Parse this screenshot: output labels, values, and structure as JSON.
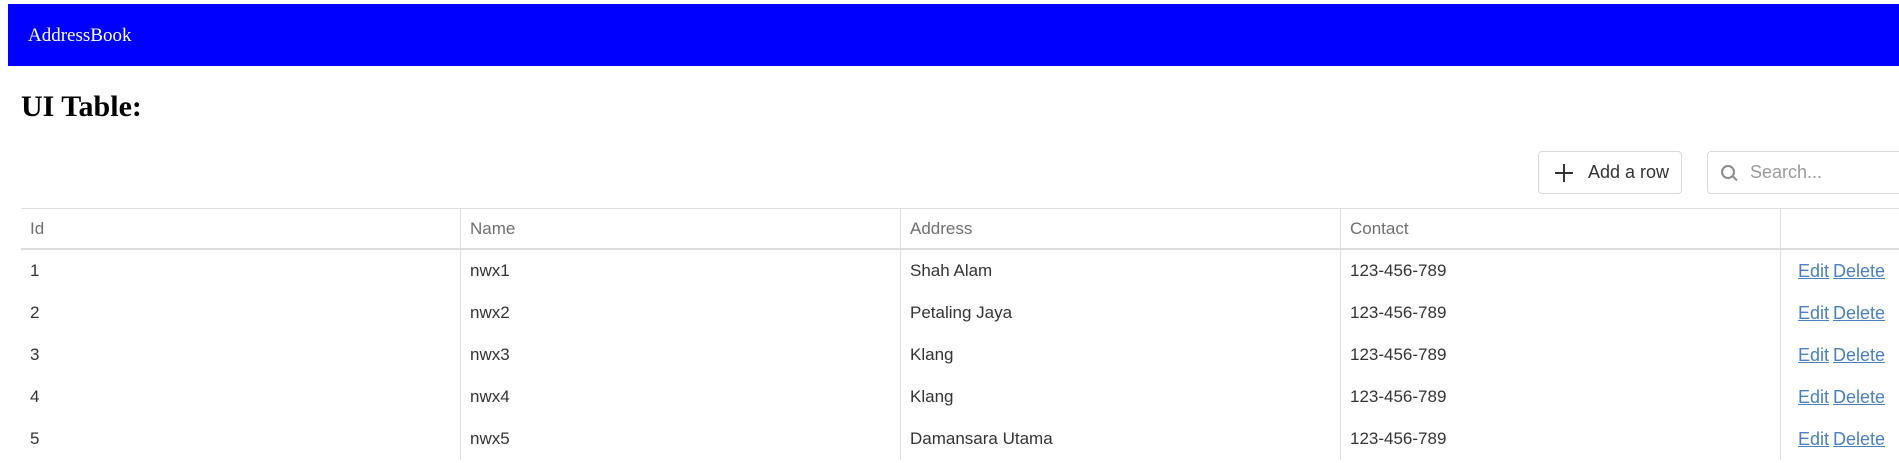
{
  "navbar": {
    "brand": "AddressBook",
    "color": "#0000ff"
  },
  "page": {
    "title": "UI Table:"
  },
  "toolbar": {
    "add_label": "Add a row",
    "search_placeholder": "Search...",
    "search_value": ""
  },
  "table": {
    "columns": [
      "Id",
      "Name",
      "Address",
      "Contact",
      ""
    ],
    "rows": [
      {
        "id": "1",
        "name": "nwx1",
        "address": "Shah Alam",
        "contact": "123-456-789",
        "edit": "Edit",
        "delete": "Delete"
      },
      {
        "id": "2",
        "name": "nwx2",
        "address": "Petaling Jaya",
        "contact": "123-456-789",
        "edit": "Edit",
        "delete": "Delete"
      },
      {
        "id": "3",
        "name": "nwx3",
        "address": "Klang",
        "contact": "123-456-789",
        "edit": "Edit",
        "delete": "Delete"
      },
      {
        "id": "4",
        "name": "nwx4",
        "address": "Klang",
        "contact": "123-456-789",
        "edit": "Edit",
        "delete": "Delete"
      },
      {
        "id": "5",
        "name": "nwx5",
        "address": "Damansara Utama",
        "contact": "123-456-789",
        "edit": "Edit",
        "delete": "Delete"
      }
    ]
  },
  "icons": {
    "add": "plus-icon",
    "search": "search-icon"
  },
  "colors": {
    "link": "#4a7fc1",
    "border": "#e0e0e0"
  }
}
